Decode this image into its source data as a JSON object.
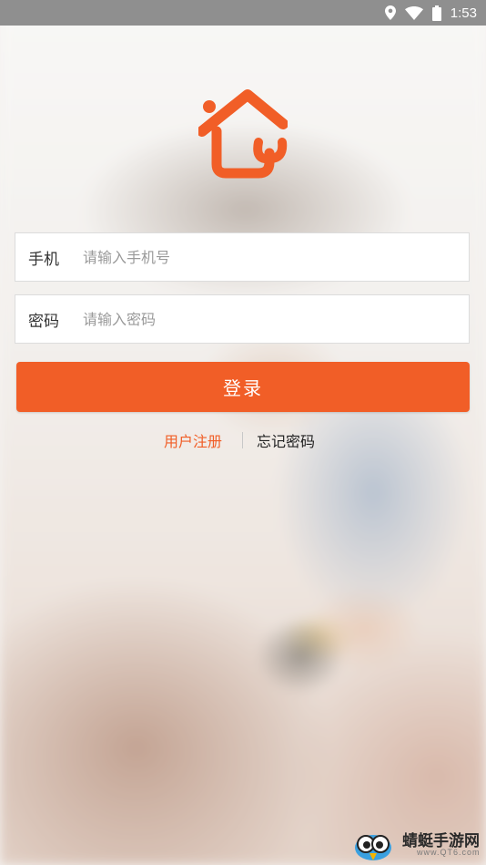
{
  "status_bar": {
    "time": "1:53",
    "icons": [
      "location-icon",
      "wifi-icon",
      "battery-icon"
    ]
  },
  "logo": {
    "icon": "house-wrench-logo",
    "color": "#f15e27"
  },
  "login_form": {
    "phone": {
      "label": "手机",
      "placeholder": "请输入手机号",
      "value": ""
    },
    "password": {
      "label": "密码",
      "placeholder": "请输入密码",
      "value": ""
    },
    "submit_label": "登录"
  },
  "links": {
    "register": "用户注册",
    "forgot_password": "忘记密码"
  },
  "watermark": {
    "title": "蜻蜓手游网",
    "subtitle": "www.QT6.com"
  },
  "colors": {
    "accent": "#f15e27",
    "status_bar_bg": "#8f8f8f"
  }
}
